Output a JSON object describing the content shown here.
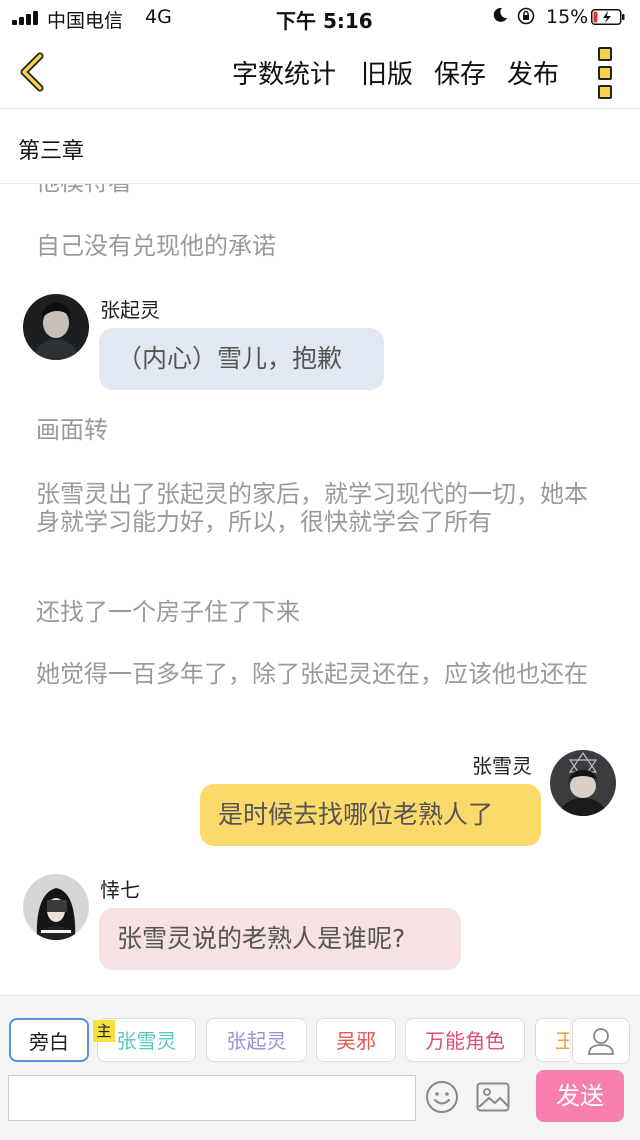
{
  "status_bar": {
    "carrier": "中国电信",
    "network": "4G",
    "time": "下午 5:16",
    "battery_pct": "15%",
    "battery_level": 0.15,
    "icons": [
      "signal-icon",
      "moon-icon",
      "rotation-lock-icon",
      "battery-charging-icon"
    ]
  },
  "nav": {
    "word_count": "字数统计",
    "old_version": "旧版",
    "save": "保存",
    "publish": "发布"
  },
  "chapter": {
    "title": "第三章"
  },
  "content": {
    "partial_line": "他模特看",
    "narr1": "自己没有兑现他的承诺",
    "msg1": {
      "speaker": "张起灵",
      "text": "（内心）雪儿，抱歉"
    },
    "narr2": "画面转",
    "narr3": "张雪灵出了张起灵的家后，就学习现代的一切，她本身就学习能力好，所以，很快就学会了所有",
    "narr4": "还找了一个房子住了下来",
    "narr5": "她觉得一百多年了，除了张起灵还在，应该他也还在",
    "msg2": {
      "speaker": "张雪灵",
      "text": "是时候去找哪位老熟人了"
    },
    "msg3": {
      "speaker": "悻七",
      "text": "张雪灵说的老熟人是谁呢?"
    }
  },
  "bottom": {
    "roles": [
      "旁白",
      "张雪灵",
      "张起灵",
      "吴邪",
      "万能角色",
      "王"
    ],
    "main_badge": "主",
    "input_placeholder": "",
    "send": "发送"
  },
  "colors": {
    "accent_yellow": "#f5d24c",
    "bubble_blue": "#e1e8f1",
    "bubble_yellow": "#fbd96a",
    "bubble_pink": "#f6e2e3",
    "send_pink": "#f77fae"
  }
}
